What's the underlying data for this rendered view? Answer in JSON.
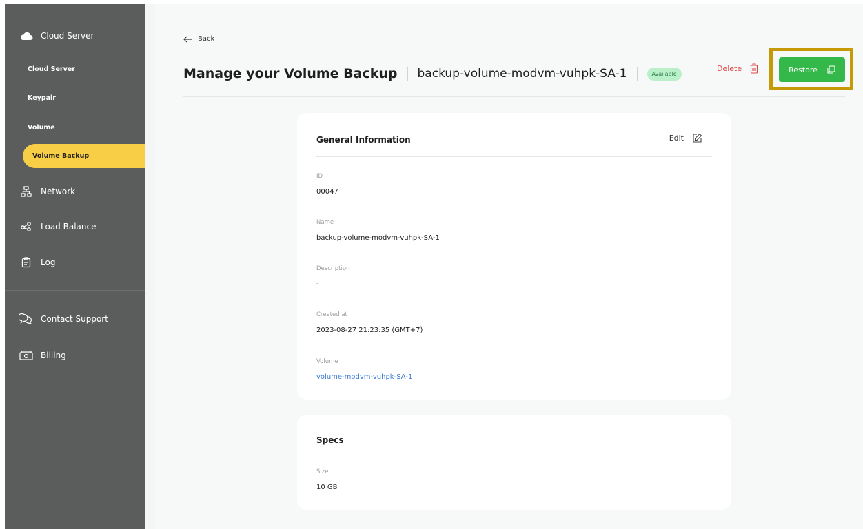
{
  "sidebar": {
    "cloud_server": "Cloud Server",
    "sub_items": [
      "Cloud Server",
      "Keypair",
      "Volume"
    ],
    "active_item": "Volume Backup",
    "network": "Network",
    "load_balance": "Load Balance",
    "log": "Log",
    "contact_support": "Contact Support",
    "billing": "Billing"
  },
  "header": {
    "back": "Back",
    "title": "Manage your Volume Backup",
    "backup_name": "backup-volume-modvm-vuhpk-SA-1",
    "status": "Available",
    "delete": "Delete",
    "restore": "Restore"
  },
  "general": {
    "title": "General Information",
    "edit": "Edit",
    "id_label": "ID",
    "id_value": "00047",
    "name_label": "Name",
    "name_value": "backup-volume-modvm-vuhpk-SA-1",
    "description_label": "Description",
    "description_value": "-",
    "created_label": "Created at",
    "created_value": "2023-08-27 21:23:35 (GMT+7)",
    "volume_label": "Volume",
    "volume_value": "volume-modvm-vuhpk-SA-1"
  },
  "specs": {
    "title": "Specs",
    "size_label": "Size",
    "size_value": "10 GB"
  },
  "colors": {
    "sidebar": "#5a5d5c",
    "active": "#f7ce46",
    "restore": "#35b84a",
    "highlight": "#c59a06",
    "delete": "#e04848"
  }
}
